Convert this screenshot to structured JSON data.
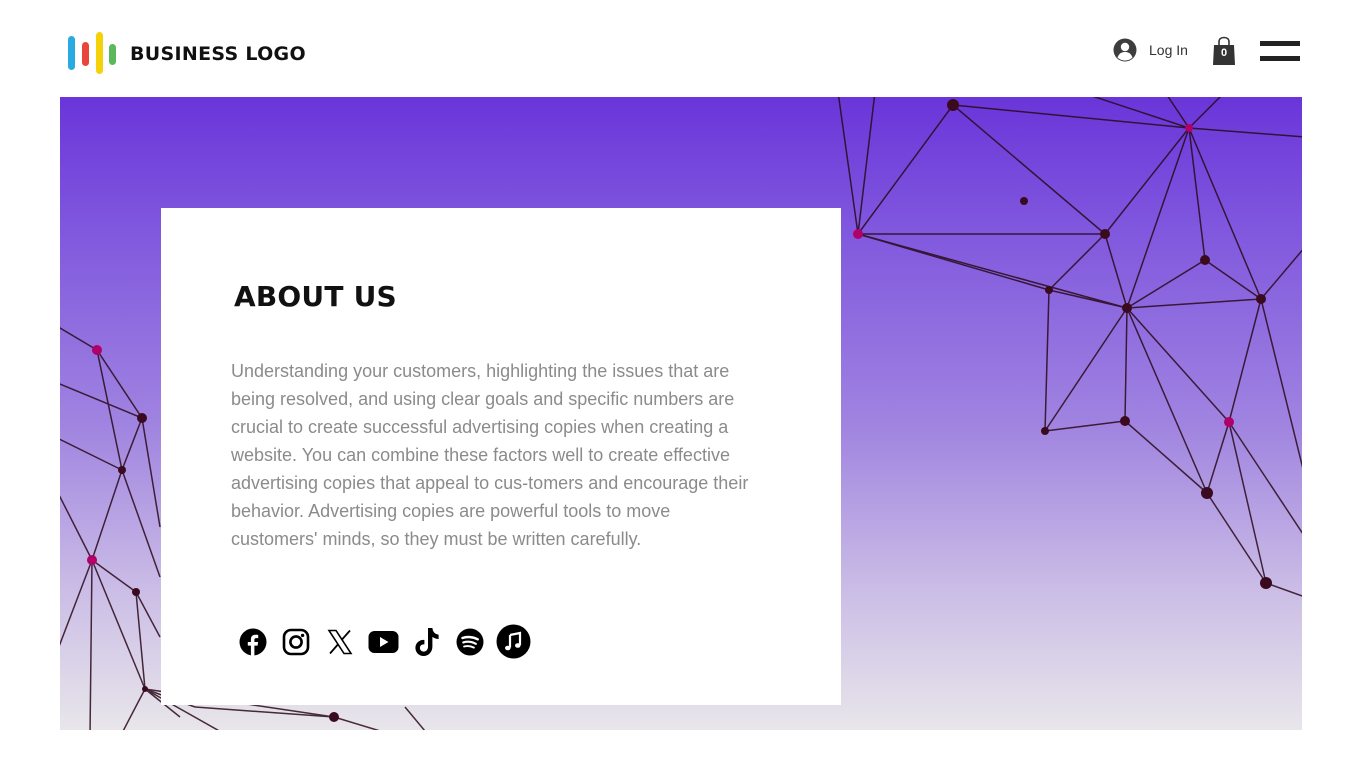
{
  "header": {
    "logo_text": "BUSINESS LOGO",
    "logo_colors": [
      "#29abe2",
      "#e8463b",
      "#f5d10a",
      "#5cb85c"
    ],
    "login_label": "Log In",
    "cart_count": "0"
  },
  "about": {
    "title": "ABOUT US",
    "body": "Understanding your customers, highlighting the issues that are being resolved, and using clear goals and specific numbers are crucial to create successful advertising copies when creating a website. You can combine these factors well to create effective advertising copies that appeal to cus-tomers and encourage their behavior. Advertising copies are powerful tools to move customers' minds, so they must be written carefully."
  },
  "social": [
    {
      "name": "facebook",
      "icon": "facebook-icon"
    },
    {
      "name": "instagram",
      "icon": "instagram-icon"
    },
    {
      "name": "x",
      "icon": "x-icon"
    },
    {
      "name": "youtube",
      "icon": "youtube-icon"
    },
    {
      "name": "tiktok",
      "icon": "tiktok-icon"
    },
    {
      "name": "spotify",
      "icon": "spotify-icon"
    },
    {
      "name": "apple-music",
      "icon": "music-note-icon"
    }
  ],
  "colors": {
    "hero_top": "#6a35d9",
    "hero_bottom": "#e8e6ea",
    "node": "#3a0a1e",
    "node_highlight": "#b0006a"
  }
}
